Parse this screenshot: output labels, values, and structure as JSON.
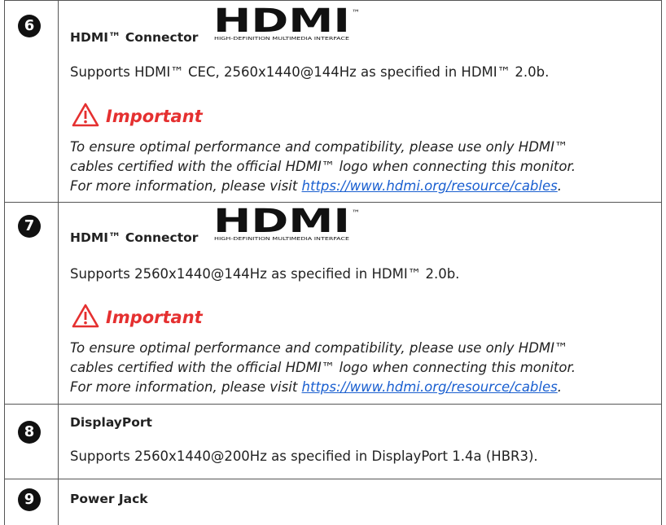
{
  "sections": [
    {
      "number": "6",
      "heading": "HDMI™ Connector",
      "logo": {
        "mark": "HDMI",
        "tagline": "HIGH-DEFINITION MULTIMEDIA INTERFACE",
        "tm": "™"
      },
      "description": "Supports HDMI™ CEC, 2560x1440@144Hz as specified in HDMI™ 2.0b.",
      "important_label": "Important",
      "important_icon": "warning-icon",
      "note_line1": "To ensure optimal performance and compatibility, please use only HDMI™",
      "note_line2": "cables certified with the official HDMI™ logo when connecting this monitor.",
      "note_line3_prefix": "For more information, please visit ",
      "note_link": "https://www.hdmi.org/resource/cables",
      "note_suffix": "."
    },
    {
      "number": "7",
      "heading": "HDMI™ Connector",
      "logo": {
        "mark": "HDMI",
        "tagline": "HIGH-DEFINITION MULTIMEDIA INTERFACE",
        "tm": "™"
      },
      "description": "Supports 2560x1440@144Hz as specified in HDMI™ 2.0b.",
      "important_label": "Important",
      "important_icon": "warning-icon",
      "note_line1": "To ensure optimal performance and compatibility, please use only HDMI™",
      "note_line2": "cables certified with the official HDMI™ logo when connecting this monitor.",
      "note_line3_prefix": "For more information, please visit ",
      "note_link": "https://www.hdmi.org/resource/cables",
      "note_suffix": "."
    },
    {
      "number": "8",
      "heading": "DisplayPort",
      "description": "Supports 2560x1440@200Hz as specified in DisplayPort 1.4a (HBR3)."
    },
    {
      "number": "9",
      "heading": "Power Jack"
    }
  ],
  "colors": {
    "badge": "#111111",
    "important": "#e53030",
    "link": "#1a5fd0",
    "border": "#555555"
  }
}
